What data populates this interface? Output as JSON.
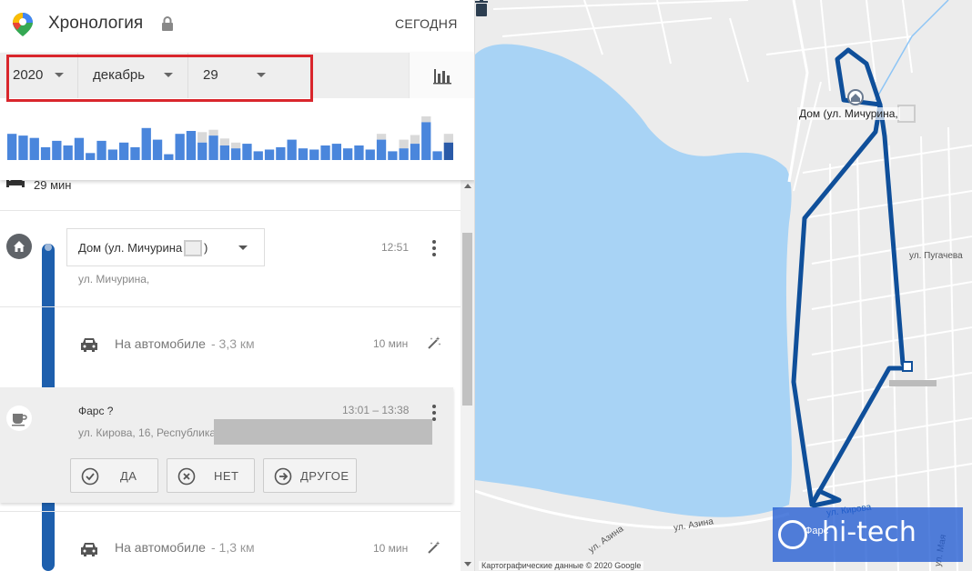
{
  "header": {
    "title": "Хронология",
    "today_label": "СЕГОДНЯ"
  },
  "date_selector": {
    "year": "2020",
    "month": "декабрь",
    "day": "29"
  },
  "histogram": {
    "values": [
      0.45,
      0.42,
      0.38,
      0.22,
      0.33,
      0.25,
      0.38,
      0.12,
      0.33,
      0.18,
      0.3,
      0.22,
      0.55,
      0.35,
      0.1,
      0.45,
      0.5,
      0.3,
      0.42,
      0.25,
      0.2,
      0.28,
      0.15,
      0.18,
      0.22,
      0.35,
      0.2,
      0.18,
      0.25,
      0.28,
      0.2,
      0.25,
      0.18,
      0.35,
      0.15,
      0.2,
      0.28,
      0.65,
      0.15,
      0.3
    ],
    "highlight_top": [
      0,
      0,
      0,
      0,
      0,
      0,
      0,
      0,
      0,
      0,
      0,
      0,
      0,
      0,
      0,
      0,
      0,
      0.18,
      0.1,
      0.12,
      0.1,
      0,
      0,
      0,
      0,
      0,
      0,
      0,
      0,
      0,
      0,
      0,
      0,
      0.1,
      0,
      0.15,
      0.15,
      0.1,
      0,
      0.15
    ]
  },
  "timeline": {
    "first_duration": "29 мин",
    "home_place": "Дом (ул. Мичурина",
    "home_place_suffix": ")",
    "home_time": "12:51",
    "home_address": "ул. Мичурина,",
    "drive1_mode": "На автомобиле",
    "drive1_distance": "- 3,3 км",
    "drive1_duration": "10 мин",
    "visit_title": "Фарс ?",
    "visit_time": "13:01 – 13:38",
    "visit_address": "ул. Кирова, 16, Республика",
    "btn_yes": "ДА",
    "btn_no": "НЕТ",
    "btn_other": "ДРУГОЕ",
    "drive2_mode": "На автомобиле",
    "drive2_distance": "- 1,3 км",
    "drive2_duration": "10 мин"
  },
  "map": {
    "home_label": "Дом (ул. Мичурина,",
    "street_pugacheva": "ул. Пугачева",
    "street_kirova": "ул. Кирова",
    "street_azina_1": "ул. Азина",
    "street_azina_2": "ул. Азина",
    "street_vertical": "ул. Мая",
    "fars_label": "Фарс",
    "attribution": "Картографические данные © 2020 Google",
    "watermark_text": "hi-tech",
    "colors": {
      "water": "#a8d3f5",
      "route": "#0f4f9a",
      "land": "#ececec"
    }
  }
}
